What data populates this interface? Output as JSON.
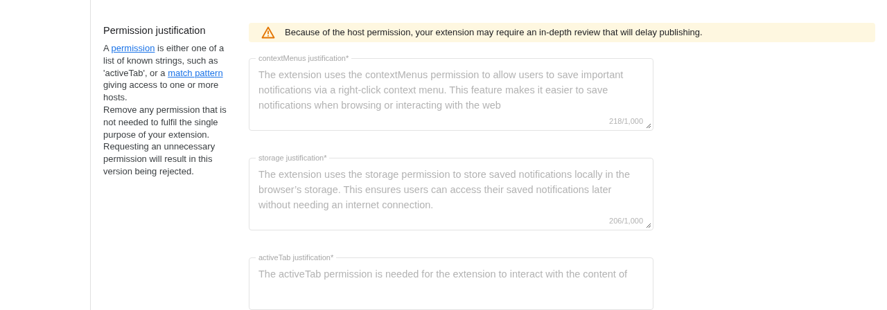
{
  "section": {
    "title": "Permission justification",
    "description": [
      {
        "text": "A "
      },
      {
        "text": "permission",
        "link": true
      },
      {
        "text": " is either one of a list of known strings, such as 'activeTab', or a "
      },
      {
        "text": "match pattern",
        "link": true
      },
      {
        "text": " giving access to one or more hosts."
      }
    ],
    "note": "Remove any permission that is not needed to fulfil the single purpose of your extension. Requesting an unnecessary permission will result in this version being rejected."
  },
  "alert": {
    "kind": "warning",
    "text": "Because of the host permission, your extension may require an in-depth review that will delay publishing."
  },
  "fields": [
    {
      "label": "contextMenus justification*",
      "value": "The extension uses the contextMenus permission to allow users to save important notifications via a right-click context menu. This feature makes it easier to save notifications when browsing or interacting with the web",
      "counter": "218/1,000",
      "disabled": true
    },
    {
      "label": "storage justification*",
      "value": "The extension uses the storage permission to store saved notifications locally in the browser’s storage. This ensures users can access their saved notifications later without needing an internet connection.",
      "counter": "206/1,000",
      "disabled": true
    },
    {
      "label": "activeTab justification*",
      "value": "The activeTab permission is needed for the extension to interact with the content of",
      "disabled": true
    }
  ]
}
